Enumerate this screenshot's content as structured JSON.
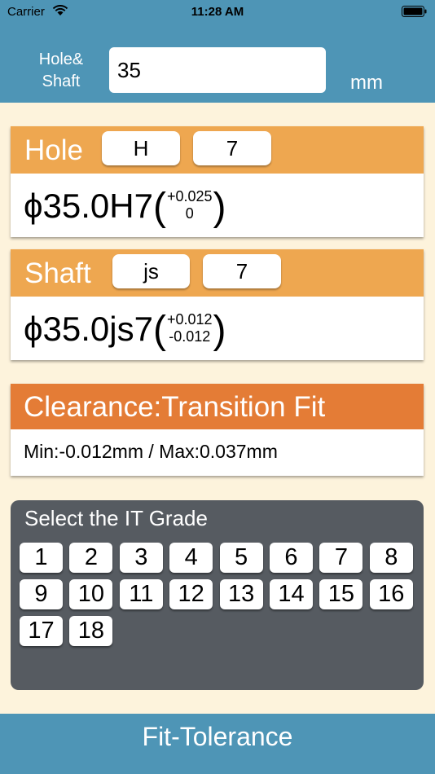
{
  "status": {
    "carrier": "Carrier",
    "time": "11:28 AM"
  },
  "size_input": {
    "label": "Hole&\nShaft",
    "value": "35",
    "unit": "mm"
  },
  "hole": {
    "title": "Hole",
    "letter": "H",
    "grade": "7",
    "code": "ϕ35.0H7",
    "upper": "+0.025",
    "lower": "0"
  },
  "shaft": {
    "title": "Shaft",
    "letter": "js",
    "grade": "7",
    "code": "ϕ35.0js7",
    "upper": "+0.012",
    "lower": "-0.012"
  },
  "fit": {
    "title": "Clearance:Transition Fit",
    "range": "Min:-0.012mm / Max:0.037mm"
  },
  "grades": {
    "title": "Select the IT Grade",
    "items": [
      "1",
      "2",
      "3",
      "4",
      "5",
      "6",
      "7",
      "8",
      "9",
      "10",
      "11",
      "12",
      "13",
      "14",
      "15",
      "16",
      "17",
      "18"
    ]
  },
  "app": {
    "title": "Fit-Tolerance"
  },
  "colors": {
    "bar_blue": "#4e95b6",
    "header_orange": "#eea750",
    "fit_orange": "#e47c36",
    "panel_gray": "#565b61",
    "background": "#fdf3dc"
  }
}
